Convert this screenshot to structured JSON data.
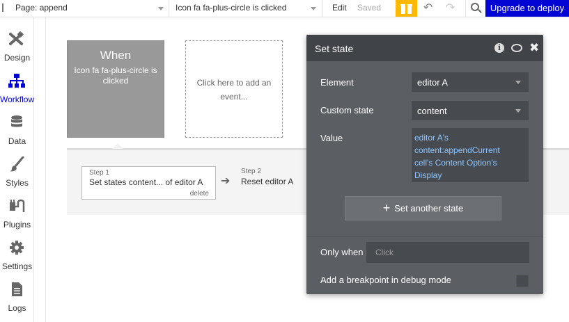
{
  "topbar": {
    "page_label": "Page: append",
    "event_label": "Icon fa fa-plus-circle is clicked",
    "edit_label": "Edit",
    "saved_label": "Saved",
    "upgrade_label": "Upgrade to deploy"
  },
  "sidebar": {
    "items": [
      {
        "label": "Design",
        "icon": "design-icon"
      },
      {
        "label": "Workflow",
        "icon": "workflow-icon"
      },
      {
        "label": "Data",
        "icon": "data-icon"
      },
      {
        "label": "Styles",
        "icon": "styles-icon"
      },
      {
        "label": "Plugins",
        "icon": "plugins-icon"
      },
      {
        "label": "Settings",
        "icon": "settings-icon"
      },
      {
        "label": "Logs",
        "icon": "logs-icon"
      }
    ],
    "active": "Workflow"
  },
  "event": {
    "title": "When",
    "description": "Icon fa fa-plus-circle is clicked",
    "add_event_text": "Click here to add an event..."
  },
  "steps": [
    {
      "number": "Step 1",
      "title": "Set states content... of editor A",
      "delete": "delete"
    },
    {
      "number": "Step 2",
      "title": "Reset editor A"
    }
  ],
  "panel": {
    "title": "Set state",
    "element_label": "Element",
    "element_value": "editor A",
    "custom_state_label": "Custom state",
    "custom_state_value": "content",
    "value_label": "Value",
    "value_lines": [
      "editor A's",
      "content:appendCurrent",
      "cell's Content Option's",
      "Display"
    ],
    "set_another_label": "Set another state",
    "only_when_label": "Only when",
    "only_when_placeholder": "Click",
    "breakpoint_label": "Add a breakpoint in debug mode"
  },
  "colors": {
    "accent": "#0205d3",
    "gift": "#ffb800",
    "panel_bg": "#5b5f63",
    "panel_header": "#404448",
    "value_text": "#8fc6ff"
  }
}
